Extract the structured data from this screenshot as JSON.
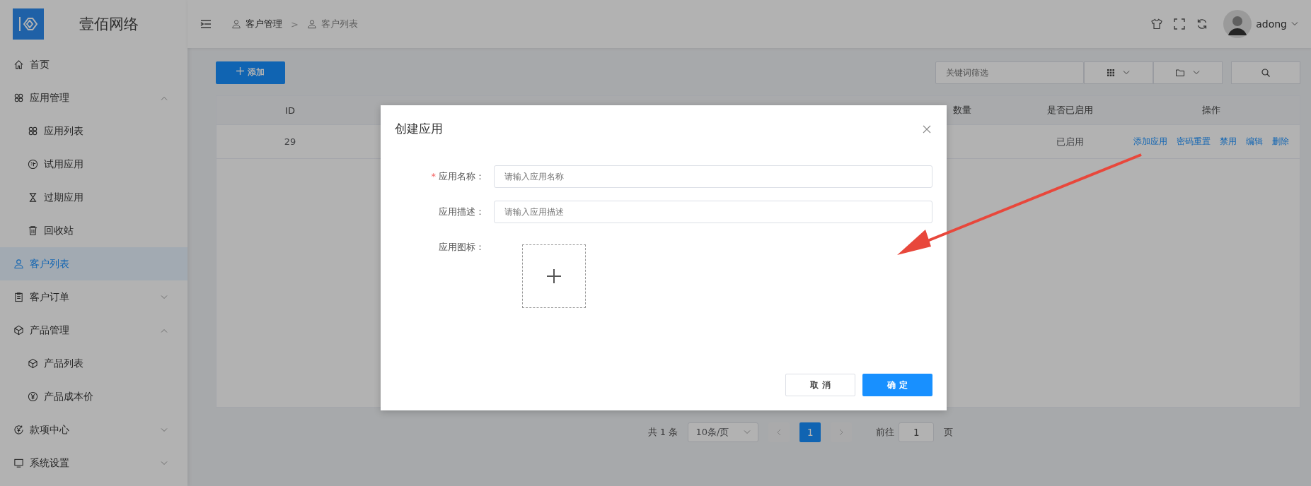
{
  "sidebar": {
    "brand": "壹佰网络",
    "items": [
      {
        "label": "首页",
        "selected": false
      },
      {
        "label": "应用管理",
        "selected": false,
        "expanded": true,
        "children": [
          {
            "label": "应用列表",
            "selected": false
          },
          {
            "label": "试用应用",
            "selected": false
          },
          {
            "label": "过期应用",
            "selected": false
          },
          {
            "label": "回收站",
            "selected": false
          }
        ]
      },
      {
        "label": "客户列表",
        "selected": true
      },
      {
        "label": "客户订单",
        "selected": false,
        "expanded": false
      },
      {
        "label": "产品管理",
        "selected": false,
        "expanded": true,
        "children": [
          {
            "label": "产品列表",
            "selected": false
          },
          {
            "label": "产品成本价",
            "selected": false
          }
        ]
      },
      {
        "label": "款项中心",
        "selected": false,
        "expanded": false
      },
      {
        "label": "系统设置",
        "selected": false,
        "expanded": false
      }
    ]
  },
  "header": {
    "breadcrumb": [
      "客户管理",
      "客户列表"
    ],
    "separator": ">",
    "user": "adong"
  },
  "toolbar": {
    "add_button": "添加",
    "search": {
      "placeholder": "关键词筛选"
    }
  },
  "table": {
    "columns": [
      "ID",
      "数量",
      "是否已启用",
      "操作"
    ],
    "rows": [
      {
        "id": "29",
        "enabled": "已启用",
        "actions": [
          "添加应用",
          "密码重置",
          "禁用",
          "编辑",
          "删除"
        ]
      }
    ]
  },
  "pagination": {
    "total": "共 1 条",
    "page_size": "10条/页",
    "pages": [
      {
        "label": "1",
        "selected": true
      }
    ],
    "goto_label": "前往",
    "goto_value": "1",
    "goto_suffix": "页"
  },
  "dialog": {
    "title": "创建应用",
    "required_mark": "*",
    "fields": [
      {
        "label": "应用名称：",
        "required": true,
        "kind": "input",
        "placeholder": "请输入应用名称"
      },
      {
        "label": "应用描述：",
        "required": false,
        "kind": "input",
        "placeholder": "请输入应用描述"
      },
      {
        "label": "应用图标：",
        "required": false,
        "kind": "upload"
      }
    ],
    "buttons": [
      {
        "label": "取 消",
        "kind": "default"
      },
      {
        "label": "确 定",
        "kind": "primary"
      }
    ]
  }
}
